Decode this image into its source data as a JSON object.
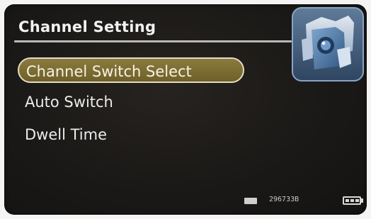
{
  "header": {
    "title": "Channel Setting",
    "icon": "camera-settings-icon"
  },
  "menu": {
    "items": [
      {
        "label": "Channel Switch Select",
        "selected": true
      },
      {
        "label": "Auto Switch",
        "selected": false
      },
      {
        "label": "Dwell Time",
        "selected": false
      }
    ]
  },
  "status_bar": {
    "storage_icon": "memory-card-icon",
    "storage_text": "296733B",
    "battery_icon": "battery-icon"
  },
  "colors": {
    "background": "#1b1917",
    "highlight": "#7a6a32",
    "highlight_border": "#e3dcc2",
    "text": "#ececec"
  }
}
